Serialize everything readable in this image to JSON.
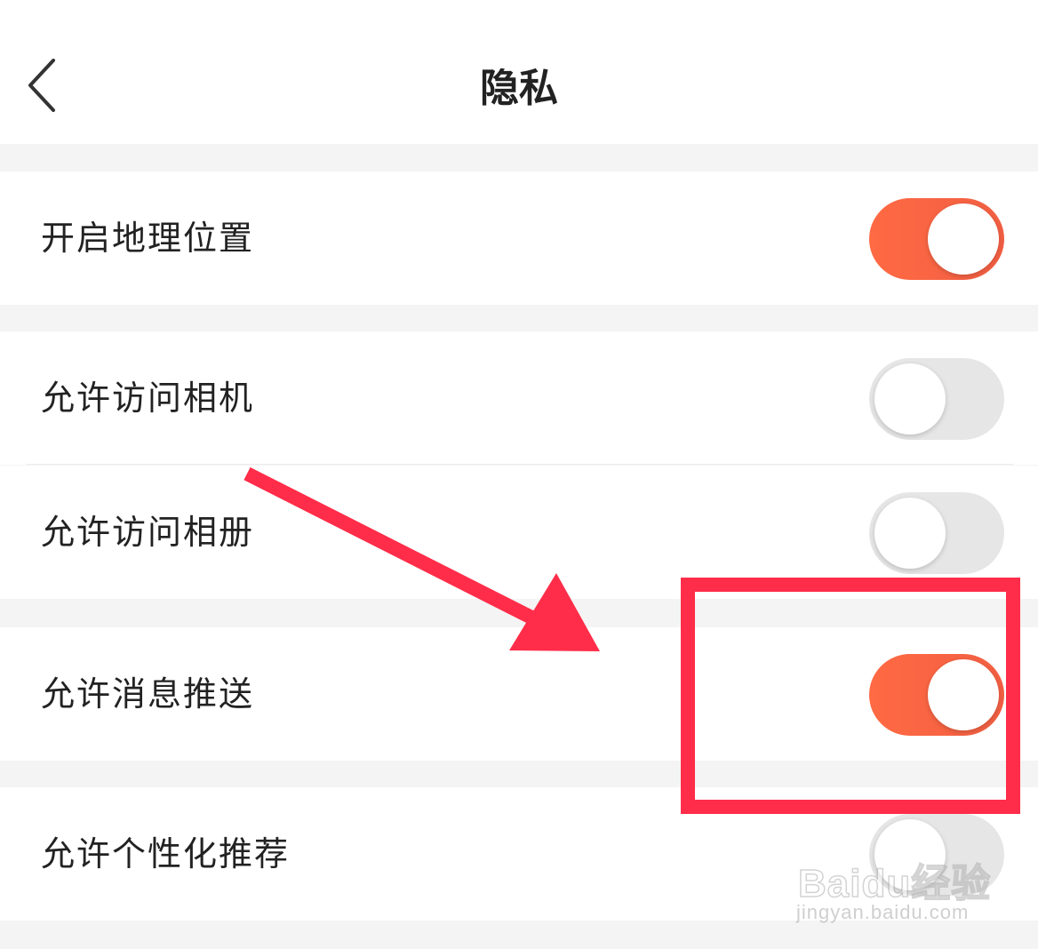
{
  "header": {
    "title": "隐私",
    "back_icon": "chevron-left-icon"
  },
  "settings": [
    {
      "label": "开启地理位置",
      "enabled": true
    },
    {
      "label": "允许访问相机",
      "enabled": false
    },
    {
      "label": "允许访问相册",
      "enabled": false
    },
    {
      "label": "允许消息推送",
      "enabled": true
    },
    {
      "label": "允许个性化推荐",
      "enabled": false
    }
  ],
  "colors": {
    "toggle_on": "#ff6a43",
    "toggle_off": "#e6e6e6",
    "annotation": "#ff2d49",
    "background": "#f4f4f4"
  },
  "annotation": {
    "type": "arrow-and-box",
    "highlighted_setting": "允许消息推送"
  },
  "watermark": {
    "brand": "Baidu经验",
    "url": "jingyan.baidu.com"
  }
}
